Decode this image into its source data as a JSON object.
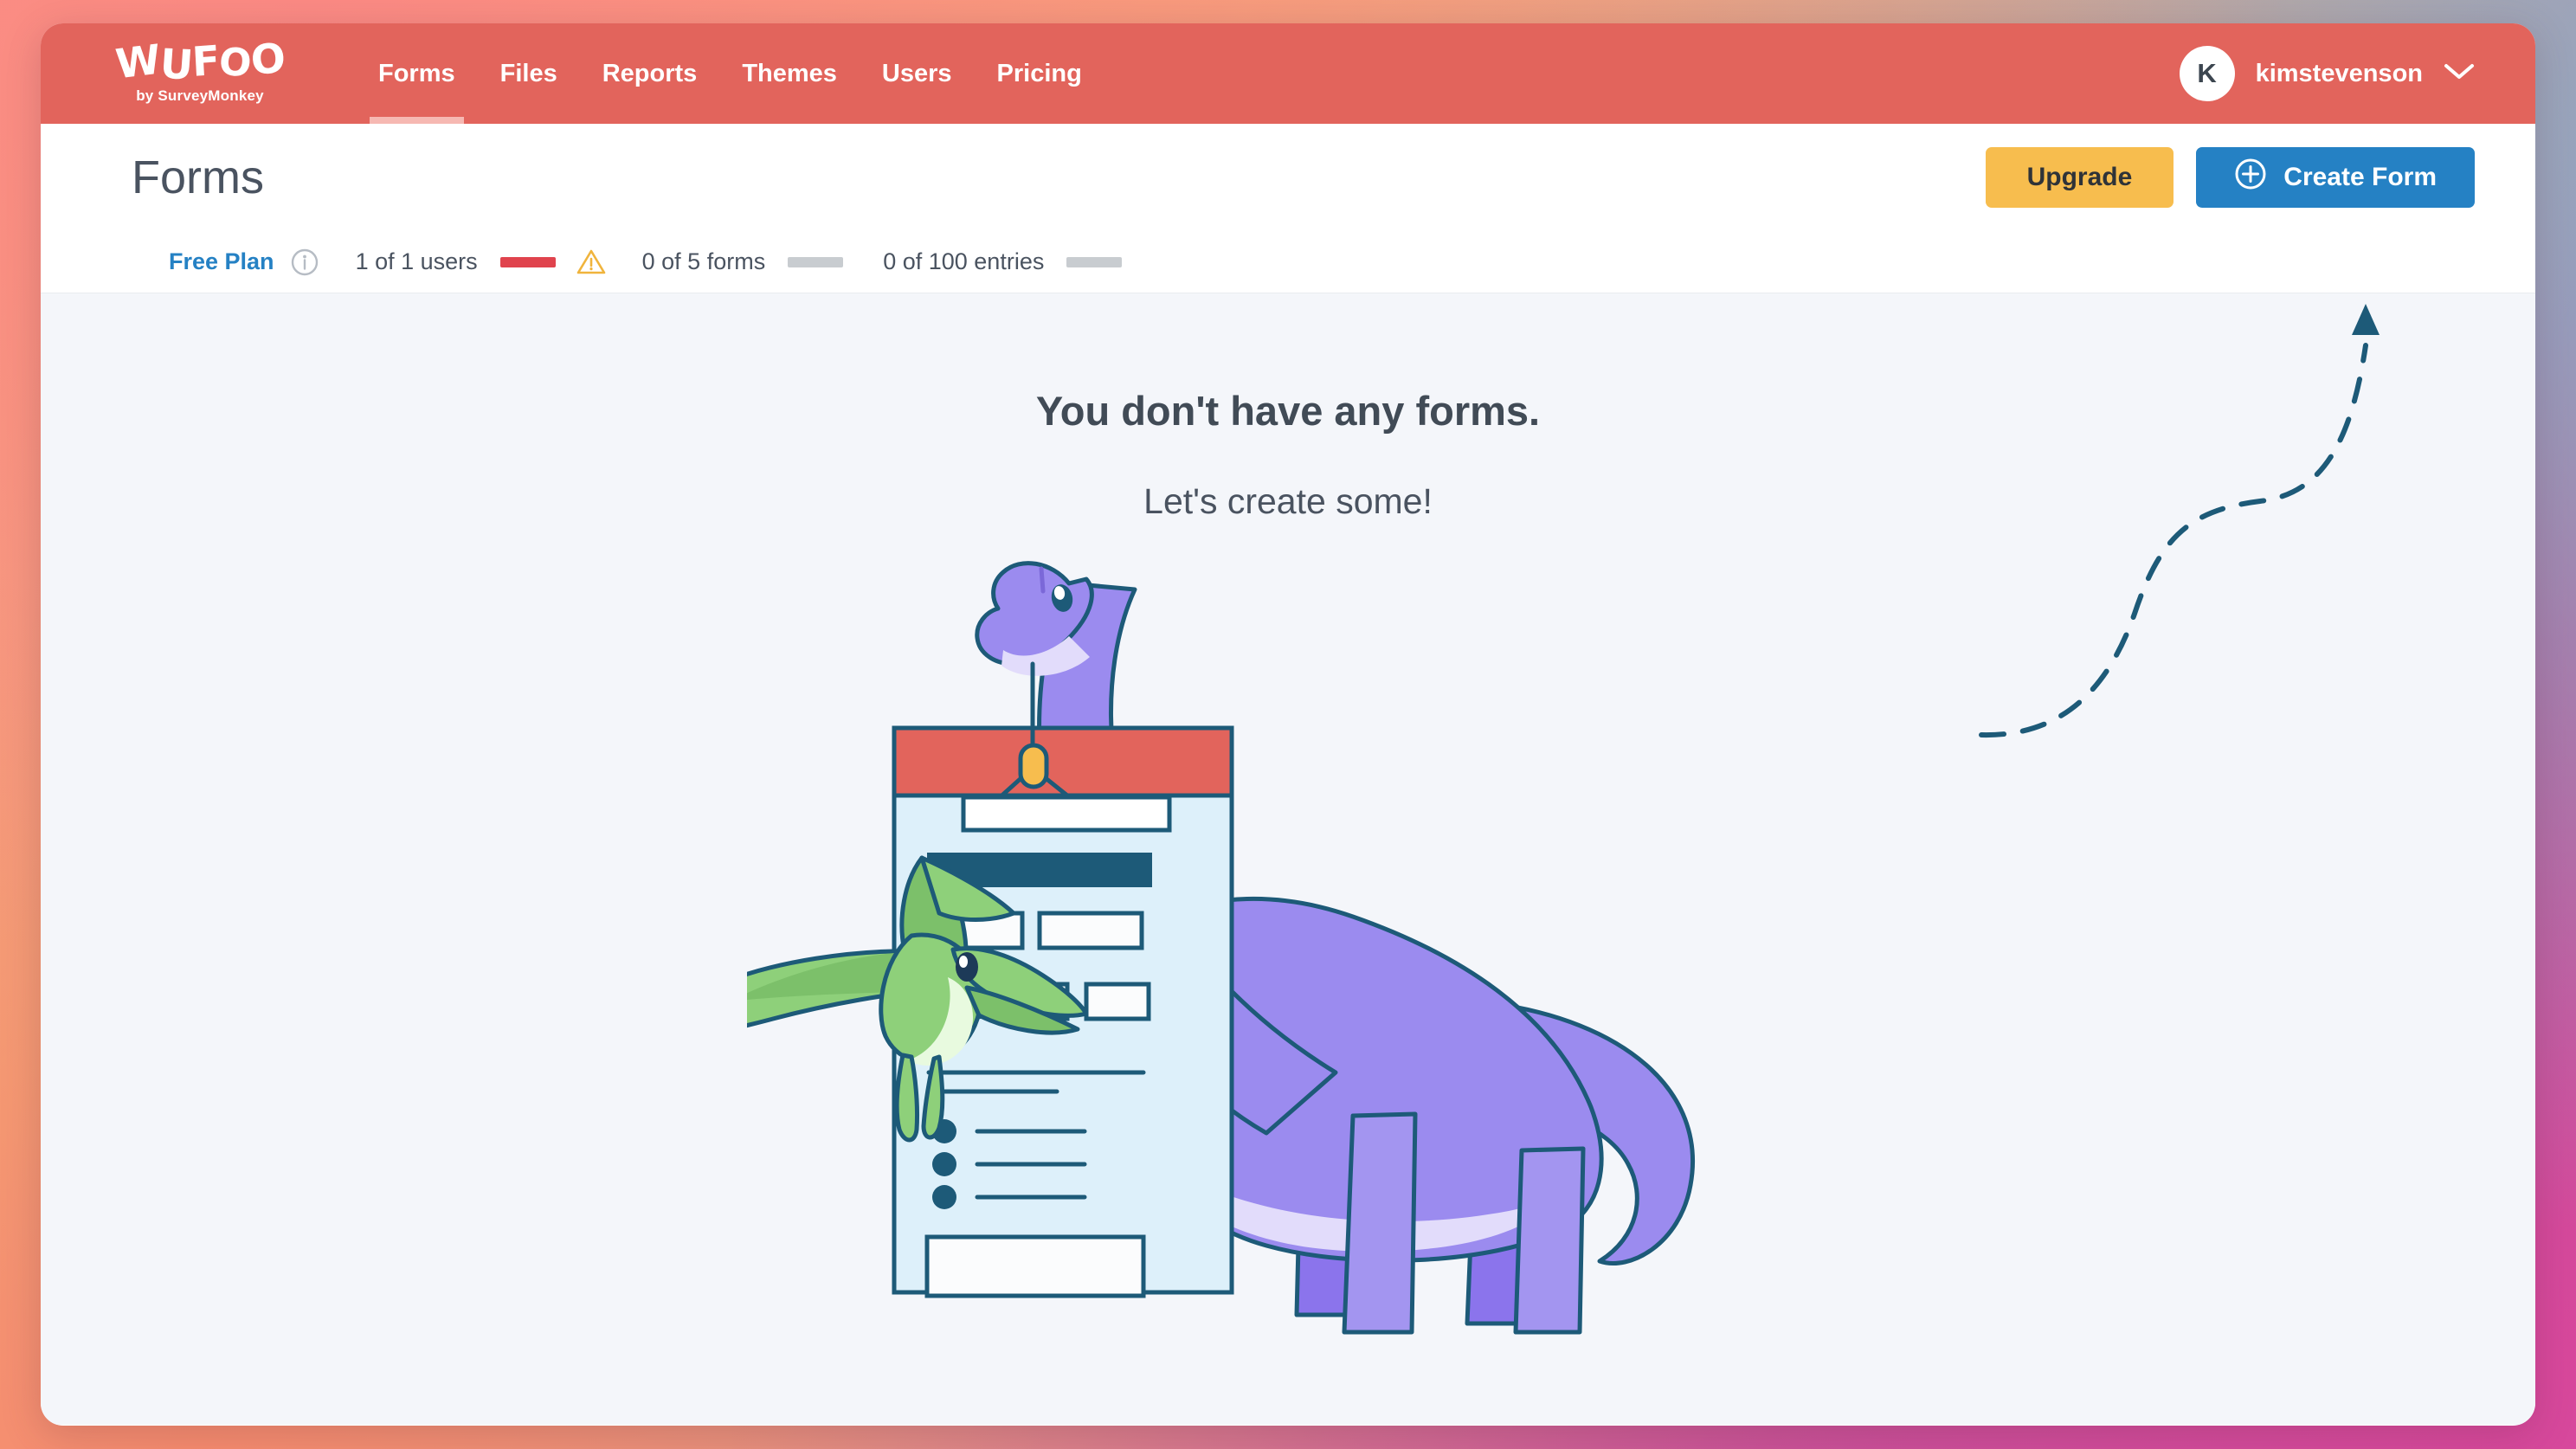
{
  "brand": {
    "logo_text": "WUFOO",
    "logo_letters": [
      "W",
      "U",
      "F",
      "O",
      "O"
    ],
    "tagline": "by SurveyMonkey",
    "nav_bg": "#e2645c",
    "accent_blue": "#2581c4",
    "accent_yellow": "#f7bd4e"
  },
  "nav": {
    "items": [
      {
        "label": "Forms",
        "active": true
      },
      {
        "label": "Files",
        "active": false
      },
      {
        "label": "Reports",
        "active": false
      },
      {
        "label": "Themes",
        "active": false
      },
      {
        "label": "Users",
        "active": false
      },
      {
        "label": "Pricing",
        "active": false
      }
    ]
  },
  "user": {
    "avatar_initial": "K",
    "username": "kimstevenson"
  },
  "header": {
    "title": "Forms",
    "upgrade_label": "Upgrade",
    "create_label": "Create Form"
  },
  "usage": {
    "plan_label": "Free Plan",
    "items": [
      {
        "label": "1 of 1 users",
        "meter": "full",
        "warning": true
      },
      {
        "label": "0 of 5 forms",
        "meter": "empty",
        "warning": false
      },
      {
        "label": "0 of 100 entries",
        "meter": "empty",
        "warning": false
      }
    ]
  },
  "empty_state": {
    "title": "You don't have any forms.",
    "subtitle": "Let's create some!"
  },
  "illustration": {
    "colors": {
      "outline": "#1d5a78",
      "form_header": "#e2645c",
      "form_body": "#ddf0fa",
      "field_fill": "#fbfcfd",
      "bar_dark": "#1d5a78",
      "dino_body": "#9b8bef",
      "dino_leg": "#8b74ec",
      "dino_belly": "#e2dcfb",
      "ptero_body": "#8ed07a",
      "ptero_wing": "#7cc06a",
      "ptero_belly": "#e8fadf",
      "pendulum": "#f7bd4e"
    }
  }
}
